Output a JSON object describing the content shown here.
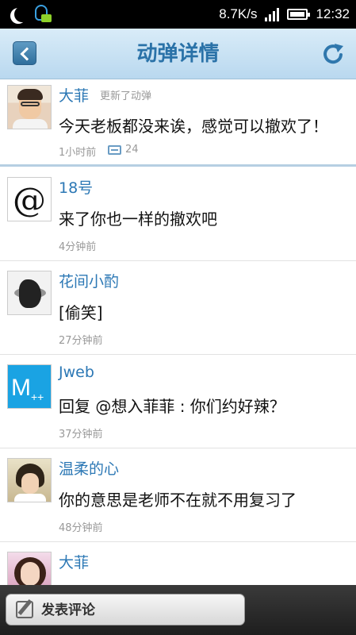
{
  "status_bar": {
    "net_speed": "8.7K/s",
    "time": "12:32"
  },
  "header": {
    "title": "动弹详情",
    "icons": [
      "back-icon",
      "refresh-icon"
    ]
  },
  "post": {
    "author": "大菲",
    "note": "更新了动弹",
    "content": "今天老板都没来诶，感觉可以撤欢了！",
    "time": "1小时前",
    "comment_count": "24"
  },
  "comments": [
    {
      "author": "18号",
      "content": "来了你也一样的撤欢吧",
      "time": "4分钟前"
    },
    {
      "author": "花间小酌",
      "content": "[偷笑]",
      "time": "27分钟前"
    },
    {
      "author": "Jweb",
      "content": "回复 @想入菲菲 : 你们约好辣？",
      "time": "37分钟前"
    },
    {
      "author": "温柔的心",
      "content": "你的意思是老师不在就不用复习了",
      "time": "48分钟前"
    },
    {
      "author": "大菲",
      "content": "",
      "time": ""
    }
  ],
  "footer": {
    "comment_button": "发表评论"
  },
  "colors": {
    "accent": "#2a72a8",
    "name": "#2c78b5"
  }
}
